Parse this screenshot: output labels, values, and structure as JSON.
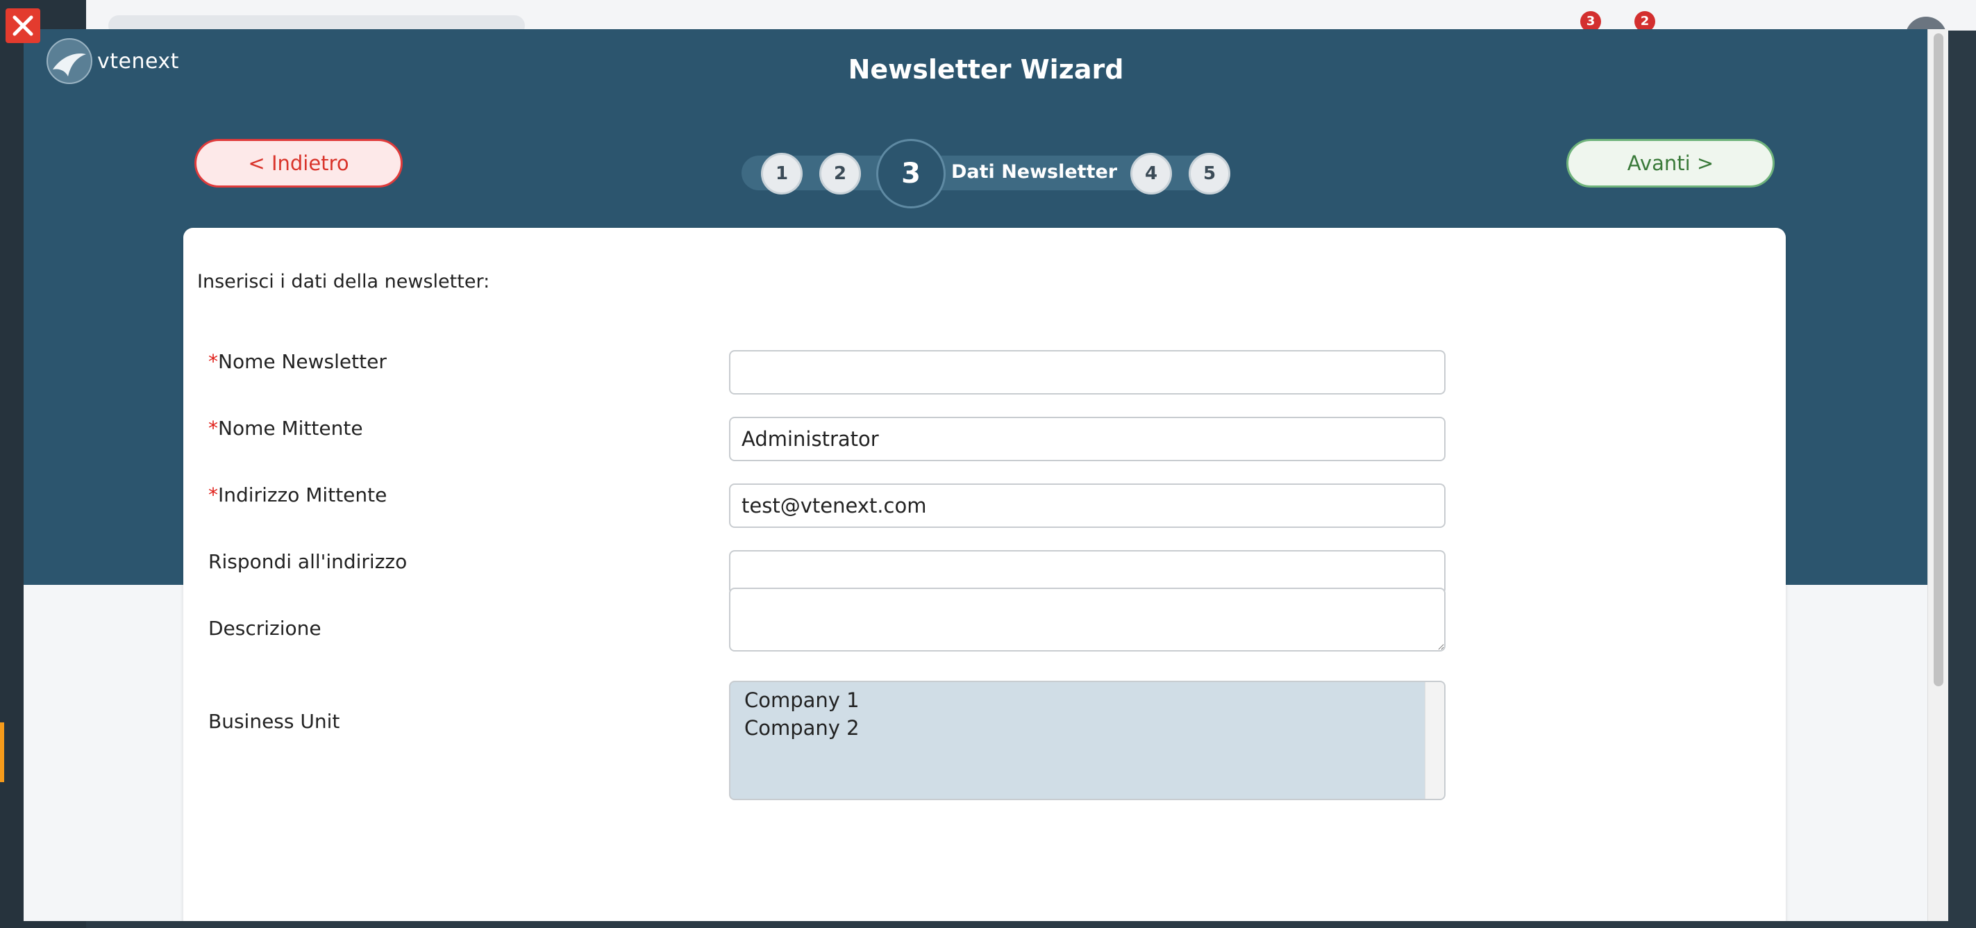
{
  "app": {
    "logo_text": "vtenext",
    "badge_1": "3",
    "badge_2": "2"
  },
  "wizard": {
    "title": "Newsletter Wizard",
    "back_label": "< Indietro",
    "next_label": "Avanti >",
    "steps": [
      "1",
      "2",
      "3",
      "4",
      "5"
    ],
    "current_step": "3",
    "current_step_label": "Dati Newsletter"
  },
  "form": {
    "intro": "Inserisci i dati della newsletter:",
    "required_mark": "*",
    "fields": {
      "nome_newsletter": {
        "label": "Nome Newsletter",
        "value": ""
      },
      "nome_mittente": {
        "label": "Nome Mittente",
        "value": "Administrator"
      },
      "indirizzo_mittente": {
        "label": "Indirizzo Mittente",
        "value": "test@vtenext.com"
      },
      "rispondi": {
        "label": "Rispondi all'indirizzo",
        "value": ""
      },
      "descrizione": {
        "label": "Descrizione",
        "value": ""
      },
      "business_unit": {
        "label": "Business Unit",
        "options": [
          "Company 1",
          "Company 2"
        ]
      }
    }
  },
  "colors": {
    "header": "#2c556e",
    "back_border": "#e03b3b",
    "next_border": "#6fb37b",
    "required": "#e0201a"
  }
}
